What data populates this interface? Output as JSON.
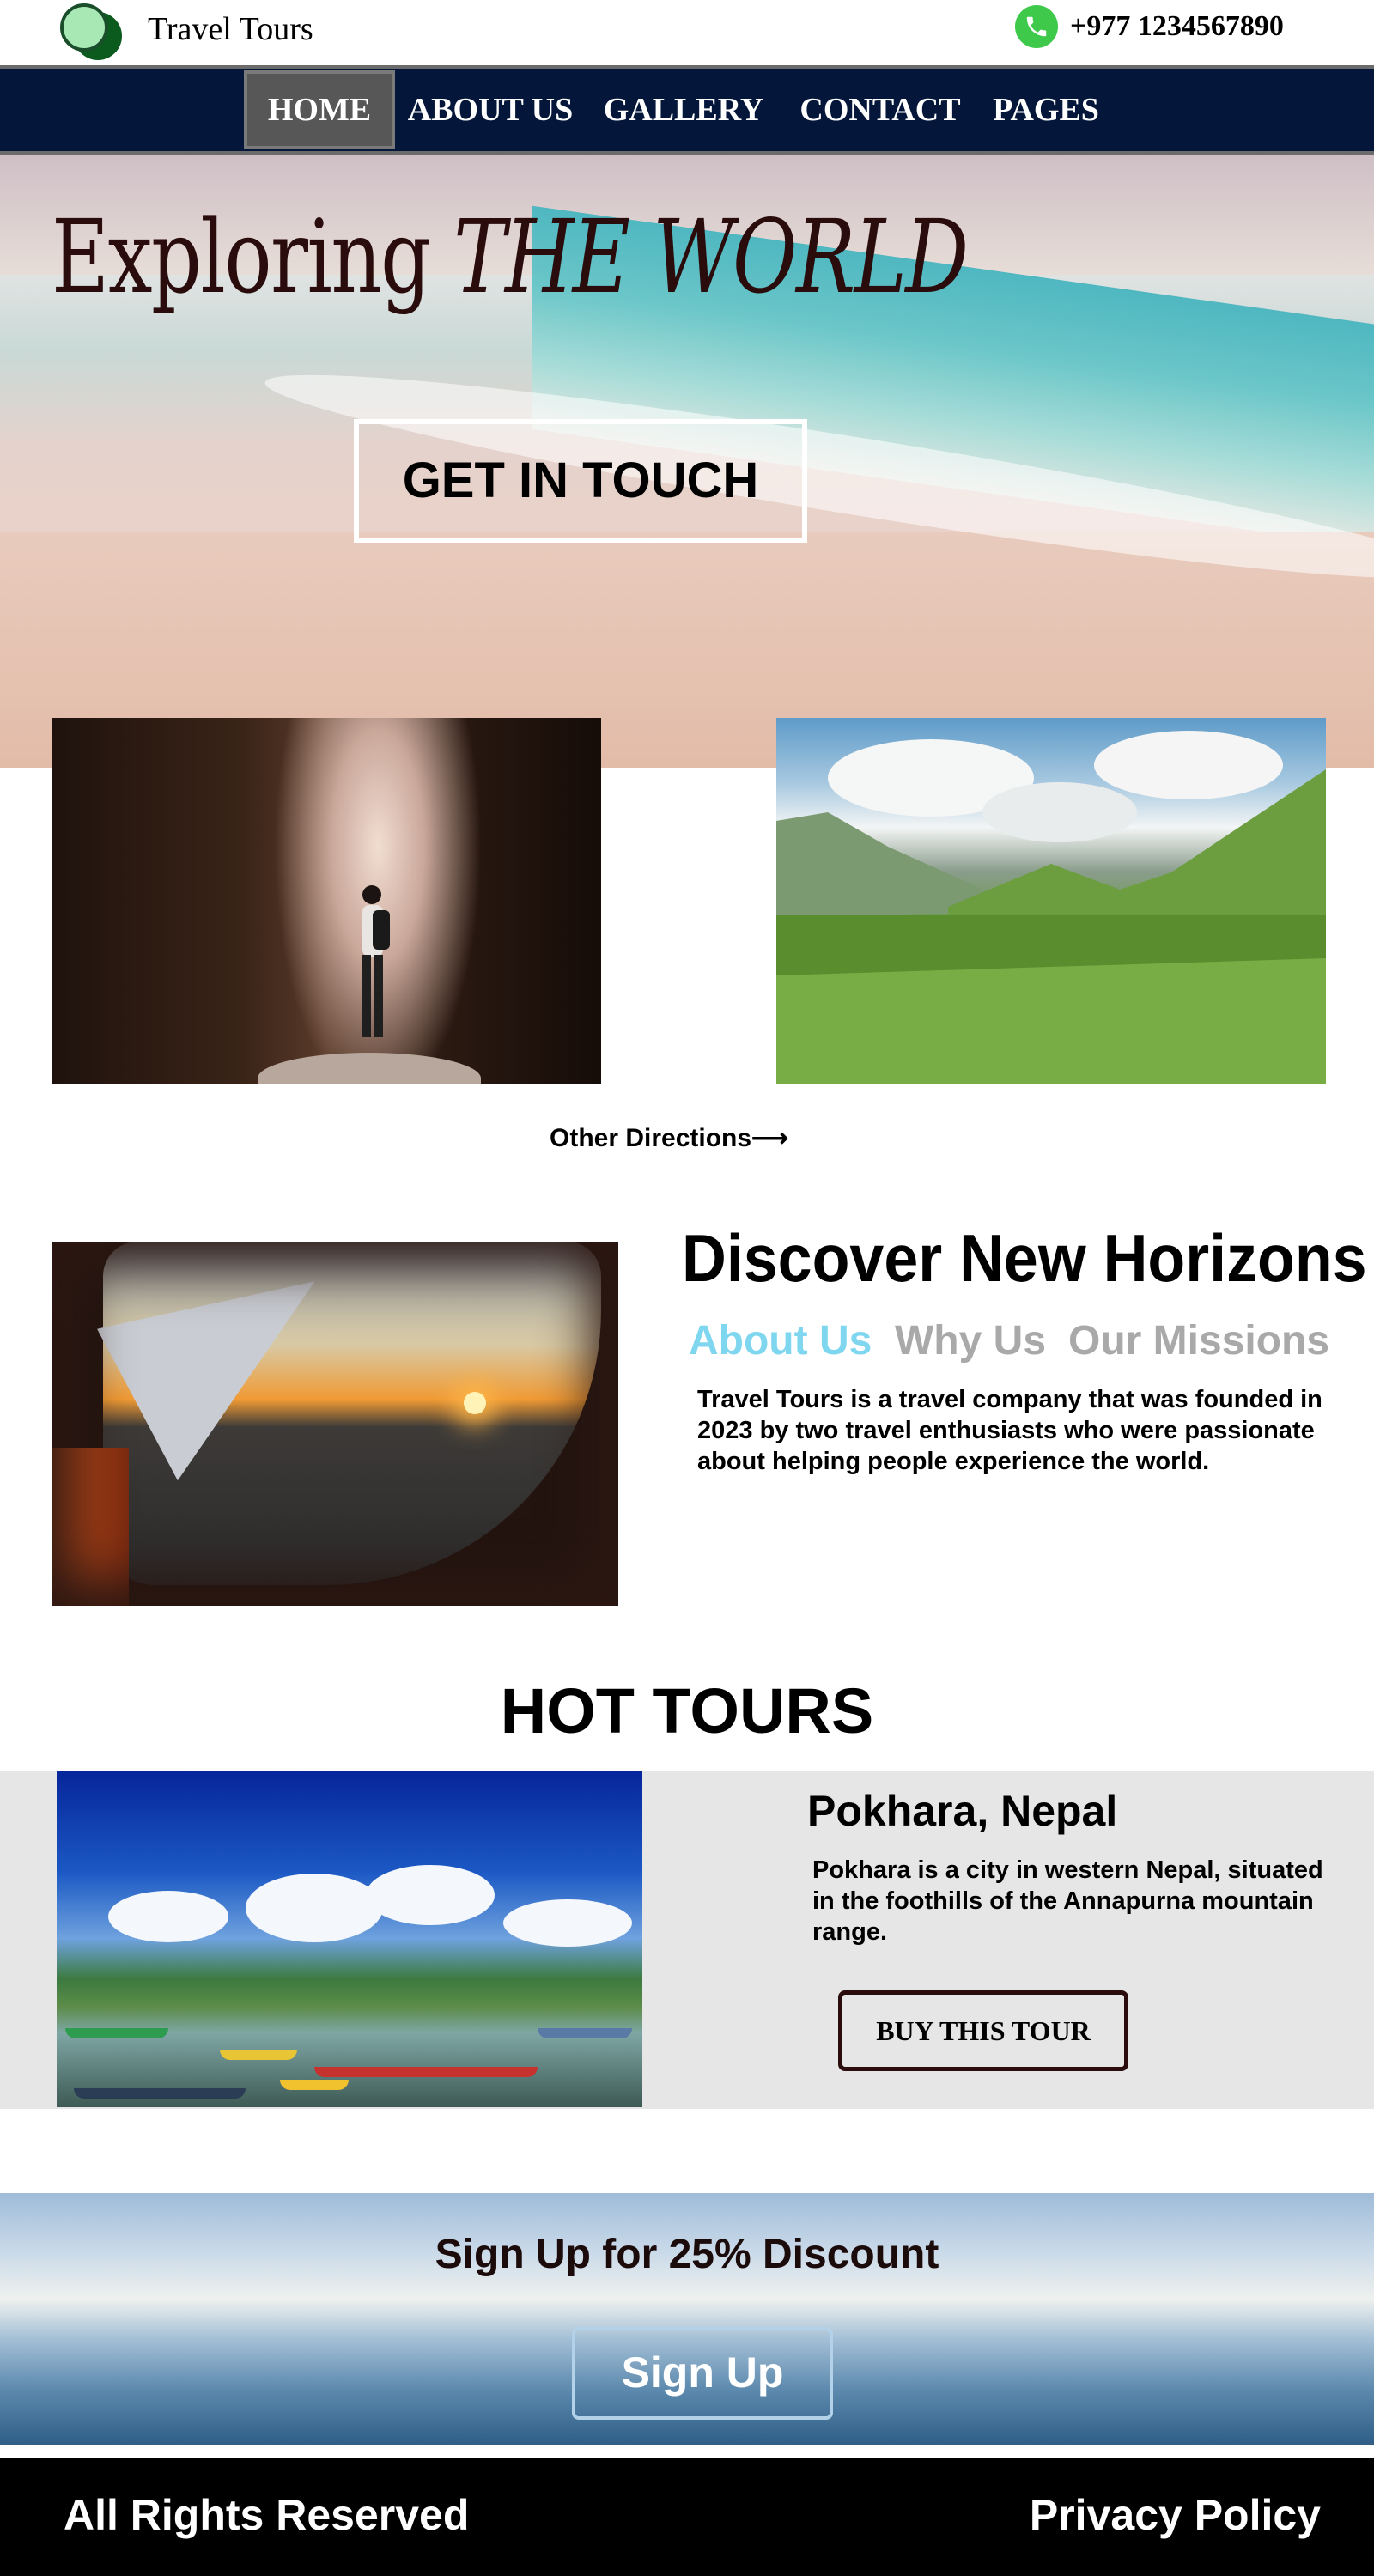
{
  "header": {
    "brand": "Travel Tours",
    "phone": "+977 1234567890",
    "icons": [
      "logo-circles",
      "phone-icon"
    ]
  },
  "nav": {
    "items": [
      {
        "label": "HOME",
        "active": true
      },
      {
        "label": "ABOUT US",
        "active": false
      },
      {
        "label": "GALLERY",
        "active": false
      },
      {
        "label": "CONTACT",
        "active": false
      },
      {
        "label": "PAGES",
        "active": false
      }
    ]
  },
  "hero": {
    "title_main": "Exploring ",
    "title_italic": "THE WORLD",
    "cta_label": "GET IN TOUCH"
  },
  "directions": {
    "link_label": "Other Directions⟶"
  },
  "discover": {
    "title": "Discover New Horizons",
    "tabs": [
      {
        "label": "About Us",
        "active": true
      },
      {
        "label": "Why Us",
        "active": false
      },
      {
        "label": "Our Missions",
        "active": false
      }
    ],
    "text": "Travel Tours is a travel company that was founded in 2023 by two travel enthusiasts who were passionate about helping people experience the world."
  },
  "hot_tours": {
    "title": "HOT TOURS",
    "tour": {
      "name": "Pokhara, Nepal",
      "description": "Pokhara is a city in western Nepal, situated in the foothills of the Annapurna mountain range.",
      "button_label": "BUY THIS TOUR"
    }
  },
  "signup": {
    "title": "Sign Up for 25% Discount",
    "button_label": "Sign Up"
  },
  "footer": {
    "left": "All Rights Reserved",
    "right": "Privacy Policy"
  },
  "colors": {
    "nav_bg": "#04173a",
    "nav_active": "#575757",
    "tab_active": "#7fd6ef",
    "tab_inactive": "#a9a9a9",
    "tour_band": "#e6e6e6",
    "footer_bg": "#000000",
    "phone_green": "#3ec94a"
  }
}
